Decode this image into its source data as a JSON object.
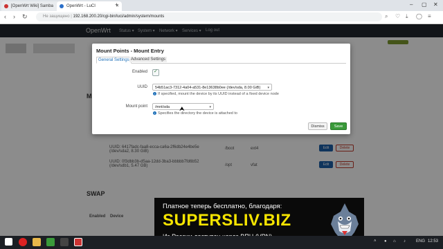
{
  "browser": {
    "tabs": [
      {
        "title": "[OpenWrt Wiki] Samba"
      },
      {
        "title": "OpenWrt - LuCI"
      }
    ],
    "address": {
      "prefix": "Не защищено",
      "url": "192.168.200.20/cgi-bin/luci/admin/system/mounts"
    }
  },
  "luci": {
    "brand": "OpenWrt",
    "nav": [
      "Status ▾",
      "System ▾",
      "Network ▾",
      "Services ▾",
      "Log out"
    ],
    "background": {
      "row1_uuid": "UUID: 6417fadc-faa8-ecca-ca6a-2f6db24e4be5e (/dev/sda2, 8.30 GiB)",
      "row1_mount": "/boot",
      "row1_fs": "ext4",
      "row2_uuid": "UUID: 0f3dbb3b-d5aa-12dd-3ba3-bbbbb7fd6b52 (/dev/sdb1, 5.47 GB)",
      "row2_mount": "/opt",
      "row2_fs": "vfat",
      "edit_label": "Edit",
      "delete_label": "Delete",
      "swap_heading": "SWAP",
      "col_enabled": "Enabled",
      "col_device": "Device"
    }
  },
  "modal": {
    "title": "Mount Points - Mount Entry",
    "tabs": [
      "General Settings",
      "Advanced Settings"
    ],
    "enabled_label": "Enabled",
    "uuid_label": "UUID",
    "uuid_value": "54b51ac3-7312-4a04-a531-8e13638b0ee (/dev/sda, 8.00 GiB)",
    "uuid_hint": "If specified, mount the device by its UUID instead of a fixed device node",
    "mount_label": "Mount point",
    "mount_value": "/mnt/sda",
    "mount_hint": "Specifies the directory the device is attached to",
    "dismiss_label": "Dismiss",
    "save_label": "Save"
  },
  "banner": {
    "line1": "Платное теперь бесплатно, благодаря:",
    "line2": "SUPERSLIV.BIZ",
    "line3": "Из России доступен через ВПН (VPN)"
  },
  "taskbar": {
    "lang": "ENG",
    "time": "12:53"
  },
  "colors": {
    "save": "#3a9a3a",
    "edit": "#1d5fa8",
    "header": "#21272e",
    "link": "#1d6fb8"
  }
}
